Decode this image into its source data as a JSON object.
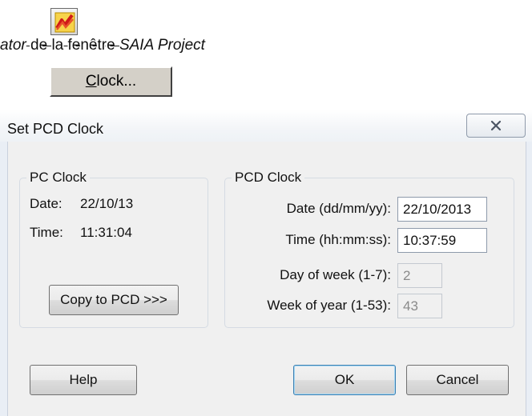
{
  "doc": {
    "icon_name": "chart-flame-icon",
    "line_text_italic_prefix": "ator",
    "line_text_mid": " de la fenêtre ",
    "line_text_italic_suffix": "SAIA Project",
    "clock_button": {
      "mnemonic": "C",
      "rest": "lock..."
    }
  },
  "dialog": {
    "title": "Set PCD Clock",
    "close_icon": "close-x-icon",
    "pc_clock": {
      "label": "PC Clock",
      "date_label": "Date:",
      "date_value": "22/10/13",
      "time_label": "Time:",
      "time_value": "11:31:04",
      "copy_button": "Copy to PCD >>>"
    },
    "pcd_clock": {
      "label": "PCD Clock",
      "date_label": "Date (dd/mm/yy):",
      "date_value": "22/10/2013",
      "time_label": "Time (hh:mm:ss):",
      "time_value": "10:37:59",
      "dow_label": "Day of week (1-7):",
      "dow_value": "2",
      "woy_label": "Week of year (1-53):",
      "woy_value": "43"
    },
    "buttons": {
      "help": "Help",
      "ok": "OK",
      "cancel": "Cancel"
    }
  },
  "colors": {
    "dialog_bg": "#f0f0f0",
    "frame": "#e9eef5",
    "accent": "#3c7fb1"
  }
}
